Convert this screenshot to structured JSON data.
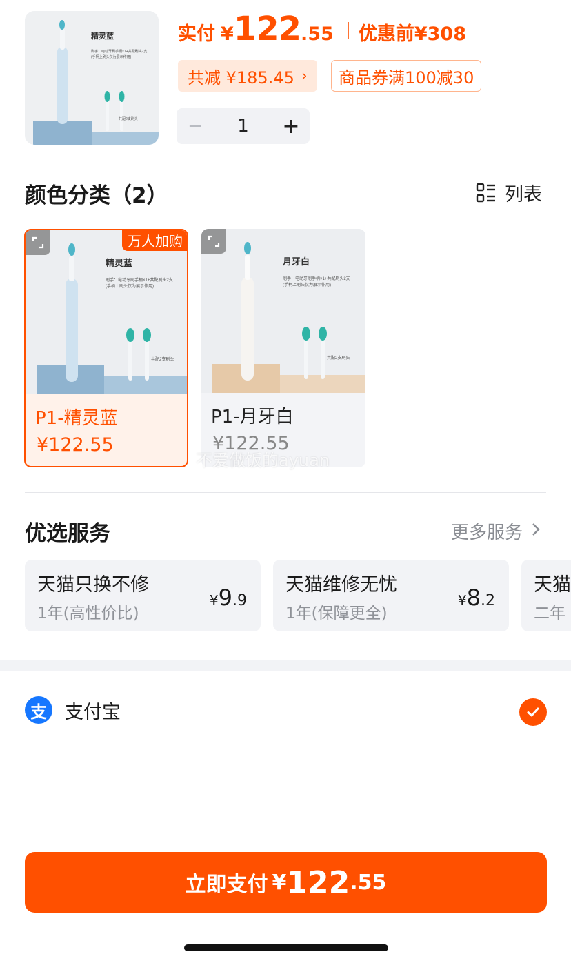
{
  "header": {
    "price_label": "实付",
    "currency": "¥",
    "price_int": "122",
    "price_dec": ".55",
    "original_label": "优惠前",
    "original_price": "¥308",
    "discount_text": "共减 ¥185.45",
    "coupon_text": "商品券满100减30",
    "quantity": "1",
    "minus": "−",
    "plus": "+"
  },
  "product_image_text": {
    "variant_blue": "精灵蓝",
    "variant_white": "月牙白",
    "desc_line1": "刷手：电动牙刷手柄×1+共配刷头2支",
    "desc_line2": "(手柄上刷头仅为展示作用)",
    "heads_note": "共配2支刷头"
  },
  "colors": {
    "title": "颜色分类（2）",
    "view_toggle": "列表",
    "hot_badge": "万人加购",
    "items": [
      {
        "name": "P1-精灵蓝",
        "price": "¥122.55",
        "selected": true
      },
      {
        "name": "P1-月牙白",
        "price": "¥122.55",
        "selected": false
      }
    ],
    "watermark": "不爱做饭的ayuan"
  },
  "services": {
    "title": "优选服务",
    "more": "更多服务",
    "items": [
      {
        "title": "天猫只换不修",
        "sub": "1年(高性价比)",
        "yen": "¥",
        "int": "9",
        "dec": ".9"
      },
      {
        "title": "天猫维修无忧",
        "sub": "1年(保障更全)",
        "yen": "¥",
        "int": "8",
        "dec": ".2"
      },
      {
        "title": "天猫",
        "sub": "二年"
      }
    ]
  },
  "payment": {
    "method": "支付宝",
    "icon_char": "支"
  },
  "pay_button": {
    "label": "立即支付",
    "currency": "¥",
    "int": "122",
    "dec": ".55"
  },
  "colors_palette": {
    "accent": "#ff5000",
    "alipay": "#1677ff",
    "blue_product": "#cfe2f0",
    "white_product": "#f6f4f1",
    "beige_stand": "#e6c9a8",
    "blue_stand": "#8fb3cf"
  }
}
